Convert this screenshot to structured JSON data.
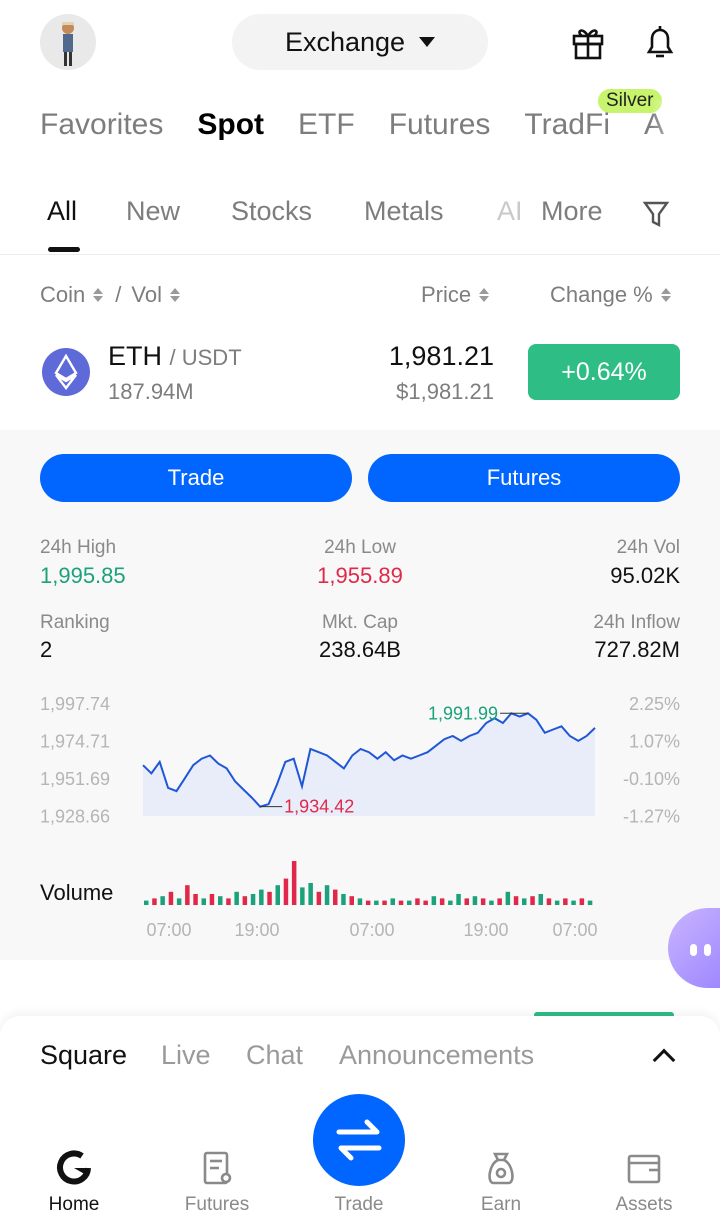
{
  "header": {
    "exchange_label": "Exchange"
  },
  "market_tabs": {
    "items": [
      "Favorites",
      "Spot",
      "ETF",
      "Futures",
      "TradFi",
      "A"
    ],
    "active": "Spot",
    "badge": "Silver"
  },
  "sub_tabs": {
    "items": [
      "All",
      "New",
      "Stocks",
      "Metals",
      "AI",
      "More"
    ],
    "active": "All"
  },
  "list_header": {
    "coin": "Coin",
    "sep": "/",
    "vol": "Vol",
    "price": "Price",
    "change": "Change %"
  },
  "coin": {
    "symbol": "ETH",
    "quote": "/ USDT",
    "volume": "187.94M",
    "price": "1,981.21",
    "price_usd": "$1,981.21",
    "change": "+0.64%",
    "change_color": "#2ebd85"
  },
  "actions": {
    "trade": "Trade",
    "futures": "Futures"
  },
  "stats": {
    "high_label": "24h High",
    "high_value": "1,995.85",
    "low_label": "24h Low",
    "low_value": "1,955.89",
    "vol_label": "24h Vol",
    "vol_value": "95.02K",
    "rank_label": "Ranking",
    "rank_value": "2",
    "mcap_label": "Mkt. Cap",
    "mcap_value": "238.64B",
    "inflow_label": "24h Inflow",
    "inflow_value": "727.82M"
  },
  "chart_data": {
    "type": "line",
    "y_ticks": [
      "1,997.74",
      "1,974.71",
      "1,951.69",
      "1,928.66"
    ],
    "y2_ticks": [
      "2.25%",
      "1.07%",
      "-0.10%",
      "-1.27%"
    ],
    "ylim": [
      1928.66,
      1997.74
    ],
    "x_ticks": [
      "07:00",
      "19:00",
      "07:00",
      "19:00",
      "07:00"
    ],
    "max_label": "1,991.99",
    "min_label": "1,934.42",
    "volume_label": "Volume",
    "series": [
      {
        "values": [
          1960,
          1955,
          1962,
          1946,
          1944,
          1952,
          1960,
          1964,
          1966,
          1961,
          1958,
          1950,
          1945,
          1940,
          1934.42,
          1936,
          1948,
          1962,
          1964,
          1947,
          1970,
          1968,
          1966,
          1962,
          1958,
          1966,
          1970,
          1968,
          1964,
          1968,
          1963,
          1966,
          1964,
          1966,
          1968,
          1972,
          1976,
          1978,
          1975,
          1978,
          1980,
          1986,
          1989,
          1986,
          1991.99,
          1990,
          1992,
          1988,
          1980,
          1982,
          1984,
          1978,
          1975,
          1978,
          1983
        ]
      }
    ],
    "volume": [
      {
        "v": 2,
        "up": true
      },
      {
        "v": 3,
        "up": false
      },
      {
        "v": 4,
        "up": true
      },
      {
        "v": 6,
        "up": false
      },
      {
        "v": 3,
        "up": true
      },
      {
        "v": 9,
        "up": false
      },
      {
        "v": 5,
        "up": false
      },
      {
        "v": 3,
        "up": true
      },
      {
        "v": 5,
        "up": false
      },
      {
        "v": 4,
        "up": true
      },
      {
        "v": 3,
        "up": false
      },
      {
        "v": 6,
        "up": true
      },
      {
        "v": 4,
        "up": false
      },
      {
        "v": 5,
        "up": true
      },
      {
        "v": 7,
        "up": true
      },
      {
        "v": 6,
        "up": false
      },
      {
        "v": 9,
        "up": true
      },
      {
        "v": 12,
        "up": false
      },
      {
        "v": 20,
        "up": false
      },
      {
        "v": 8,
        "up": true
      },
      {
        "v": 10,
        "up": true
      },
      {
        "v": 6,
        "up": false
      },
      {
        "v": 9,
        "up": true
      },
      {
        "v": 7,
        "up": false
      },
      {
        "v": 5,
        "up": true
      },
      {
        "v": 4,
        "up": false
      },
      {
        "v": 3,
        "up": true
      },
      {
        "v": 2,
        "up": false
      },
      {
        "v": 2,
        "up": true
      },
      {
        "v": 2,
        "up": false
      },
      {
        "v": 3,
        "up": true
      },
      {
        "v": 2,
        "up": false
      },
      {
        "v": 2,
        "up": true
      },
      {
        "v": 3,
        "up": false
      },
      {
        "v": 2,
        "up": false
      },
      {
        "v": 4,
        "up": true
      },
      {
        "v": 3,
        "up": false
      },
      {
        "v": 2,
        "up": true
      },
      {
        "v": 5,
        "up": true
      },
      {
        "v": 3,
        "up": false
      },
      {
        "v": 4,
        "up": true
      },
      {
        "v": 3,
        "up": false
      },
      {
        "v": 2,
        "up": true
      },
      {
        "v": 3,
        "up": false
      },
      {
        "v": 6,
        "up": true
      },
      {
        "v": 4,
        "up": false
      },
      {
        "v": 3,
        "up": true
      },
      {
        "v": 4,
        "up": false
      },
      {
        "v": 5,
        "up": true
      },
      {
        "v": 3,
        "up": false
      },
      {
        "v": 2,
        "up": true
      },
      {
        "v": 3,
        "up": false
      },
      {
        "v": 2,
        "up": true
      },
      {
        "v": 3,
        "up": false
      },
      {
        "v": 2,
        "up": true
      }
    ],
    "colors": {
      "line": "#1f57d6",
      "up": "#1ba27a",
      "down": "#e0294a"
    }
  },
  "feed_tabs": {
    "items": [
      "Square",
      "Live",
      "Chat",
      "Announcements"
    ],
    "active": "Square"
  },
  "bottom_nav": {
    "items": [
      "Home",
      "Futures",
      "Trade",
      "Earn",
      "Assets"
    ],
    "active": "Home"
  }
}
